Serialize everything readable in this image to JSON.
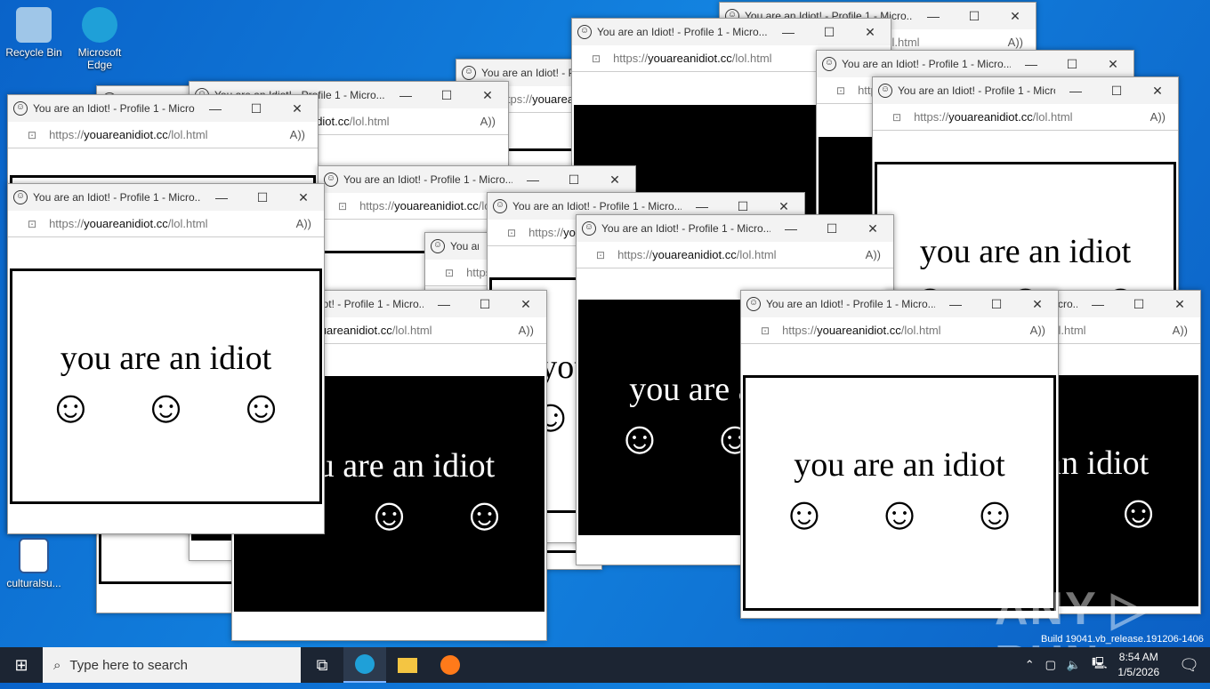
{
  "desktop": {
    "icons": [
      {
        "label": "Recycle Bin",
        "color": "#9fc6e8"
      },
      {
        "label": "Microsoft Edge",
        "color": "#1fa0d8"
      },
      {
        "label": "culturalsu...",
        "color": "#2b5797"
      }
    ]
  },
  "window": {
    "title": "You are an Idiot! - Profile 1 - Micro...",
    "url_host": "youareanidiot.cc",
    "url_prefix": "https://",
    "url_path": "/lol.html",
    "message": "you are an idiot",
    "smiley": "☺",
    "minimize": "—",
    "maximize": "☐",
    "close": "✕",
    "lock": "🔒",
    "read_aloud": "A⁾"
  },
  "taskbar": {
    "search_placeholder": "Type here to search",
    "time": "8:54 AM",
    "date": "1/5/2026"
  },
  "watermark": "ANY ▷ RUN",
  "build_text": "Build 19041.vb_release.191206-1406"
}
